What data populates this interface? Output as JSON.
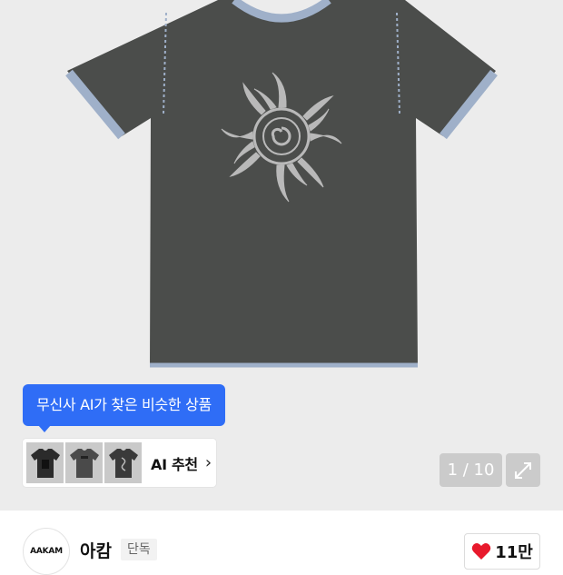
{
  "product": {
    "image_alt_icon": "tshirt-sun-print-image"
  },
  "ai": {
    "tooltip": "무신사 AI가 찾은 비슷한 상품",
    "label": "AI 추천",
    "chevron": "›"
  },
  "gallery": {
    "counter": "1 / 10"
  },
  "seller": {
    "logo_text": "AAKAM",
    "name": "아캄",
    "badge": "단독"
  },
  "like": {
    "count": "11만"
  },
  "colors": {
    "accent": "#2f6df6",
    "heart": "#e8192c",
    "shirt": "#4b4d4b",
    "trim": "#9fb0c9"
  }
}
